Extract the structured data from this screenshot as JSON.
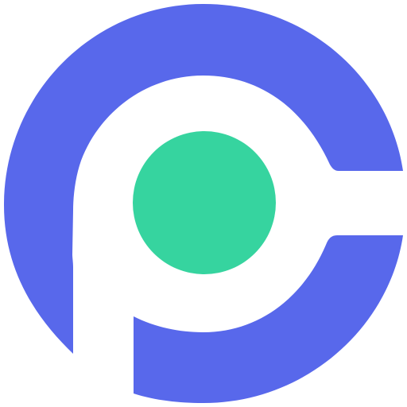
{
  "logo": {
    "icon": "p-letter-circle-logo",
    "colors": {
      "primary": "#5868EB",
      "accent": "#36D49F",
      "background": "#FFFFFF"
    }
  }
}
